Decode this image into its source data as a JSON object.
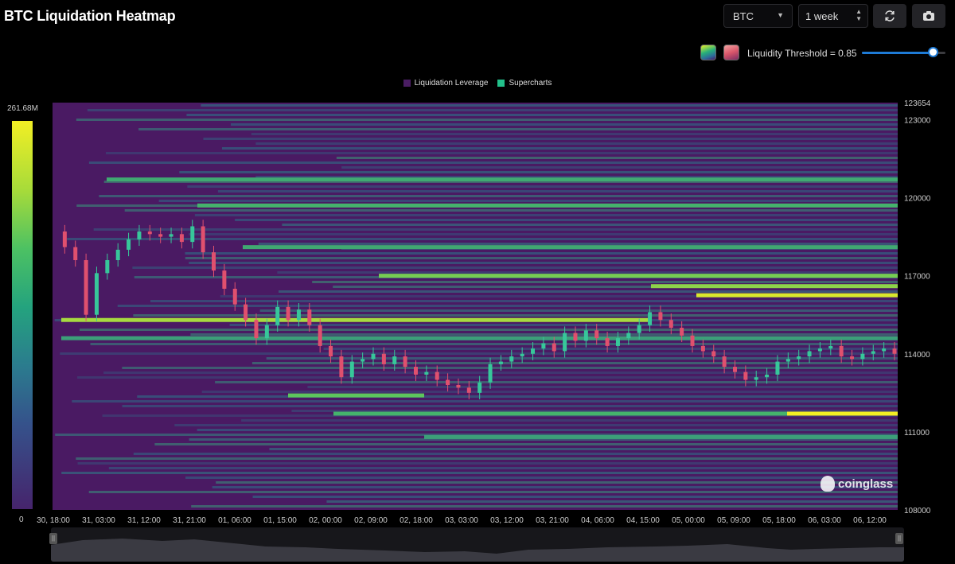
{
  "header": {
    "title": "BTC Liquidation Heatmap",
    "coin_select": "BTC",
    "range_select": "1 week",
    "refresh_icon": "refresh-icon",
    "camera_icon": "camera-icon"
  },
  "controls": {
    "threshold_label": "Liquidity Threshold = 0.85",
    "threshold_value": 0.85,
    "palette_swatches": [
      "#34b37a",
      "#d9566a"
    ]
  },
  "legend": [
    {
      "label": "Liquidation Leverage",
      "color": "#4a1d63"
    },
    {
      "label": "Supercharts",
      "color": "#22c08a"
    }
  ],
  "colorbar": {
    "max_label": "261.68M",
    "min_label": "0"
  },
  "watermark": "coinglass",
  "chart_data": {
    "type": "heatmap",
    "title": "BTC Liquidation Heatmap",
    "x_tick_labels": [
      "30, 18:00",
      "31, 03:00",
      "31, 12:00",
      "31, 21:00",
      "01, 06:00",
      "01, 15:00",
      "02, 00:00",
      "02, 09:00",
      "02, 18:00",
      "03, 03:00",
      "03, 12:00",
      "03, 21:00",
      "04, 06:00",
      "04, 15:00",
      "05, 00:00",
      "05, 09:00",
      "05, 18:00",
      "06, 03:00",
      "06, 12:00"
    ],
    "y_tick_labels": [
      "123654",
      "123000",
      "120000",
      "117000",
      "114000",
      "111000",
      "108000"
    ],
    "y_tick_values": [
      123654,
      123000,
      120000,
      117000,
      114000,
      111000,
      108000
    ],
    "ylim": [
      108000,
      123654
    ],
    "colorscale_range": [
      0,
      261680000
    ],
    "colorscale_unit_label": "261.68M",
    "colors": {
      "background": "#4a1a63",
      "low": "#46246c",
      "mid": "#2b7c8e",
      "high": "#4cc163",
      "peak": "#f2ef24"
    },
    "price_series": {
      "name": "",
      "x_start": "30, 18:00",
      "x_end": "06, 15:00",
      "values": [
        118700,
        118100,
        117600,
        115500,
        117100,
        117600,
        118000,
        118400,
        118700,
        118600,
        118500,
        118600,
        118300,
        118900,
        117900,
        117200,
        116500,
        115900,
        115300,
        114600,
        115100,
        115800,
        115300,
        115700,
        115100,
        114300,
        113900,
        113100,
        113700,
        113800,
        114000,
        113600,
        113900,
        113500,
        113200,
        113300,
        113000,
        112800,
        112700,
        112500,
        112900,
        113600,
        113700,
        113900,
        114000,
        114200,
        114400,
        114100,
        114800,
        114500,
        114900,
        114600,
        114300,
        114600,
        114800,
        115100,
        115600,
        115300,
        115000,
        114700,
        114300,
        114100,
        113900,
        113500,
        113300,
        113000,
        113100,
        113200,
        113700,
        113800,
        113900,
        114100,
        114200,
        114300,
        113900,
        113800,
        114000,
        114100,
        114200,
        114000
      ]
    },
    "liquidity_bands": [
      {
        "price": 116250,
        "level": 0.95,
        "from": "05, 00:00",
        "to": "06, 15:00"
      },
      {
        "price": 116600,
        "level": 0.8,
        "from": "04, 15:00",
        "to": "06, 15:00"
      },
      {
        "price": 117000,
        "level": 0.75,
        "from": "02, 09:00",
        "to": "06, 15:00"
      },
      {
        "price": 115300,
        "level": 0.85,
        "from": "30, 18:00",
        "to": "04, 15:00"
      },
      {
        "price": 111700,
        "level": 1.0,
        "from": "05, 18:00",
        "to": "06, 15:00"
      },
      {
        "price": 111700,
        "level": 0.6,
        "from": "02, 00:00",
        "to": "05, 18:00"
      },
      {
        "price": 112400,
        "level": 0.7,
        "from": "01, 15:00",
        "to": "02, 18:00"
      },
      {
        "price": 119700,
        "level": 0.6,
        "from": "31, 21:00",
        "to": "06, 15:00"
      },
      {
        "price": 120700,
        "level": 0.55,
        "from": "31, 03:00",
        "to": "06, 15:00"
      },
      {
        "price": 118100,
        "level": 0.55,
        "from": "01, 06:00",
        "to": "06, 15:00"
      },
      {
        "price": 114600,
        "level": 0.5,
        "from": "30, 18:00",
        "to": "06, 15:00"
      },
      {
        "price": 110800,
        "level": 0.5,
        "from": "02, 18:00",
        "to": "06, 15:00"
      }
    ]
  }
}
